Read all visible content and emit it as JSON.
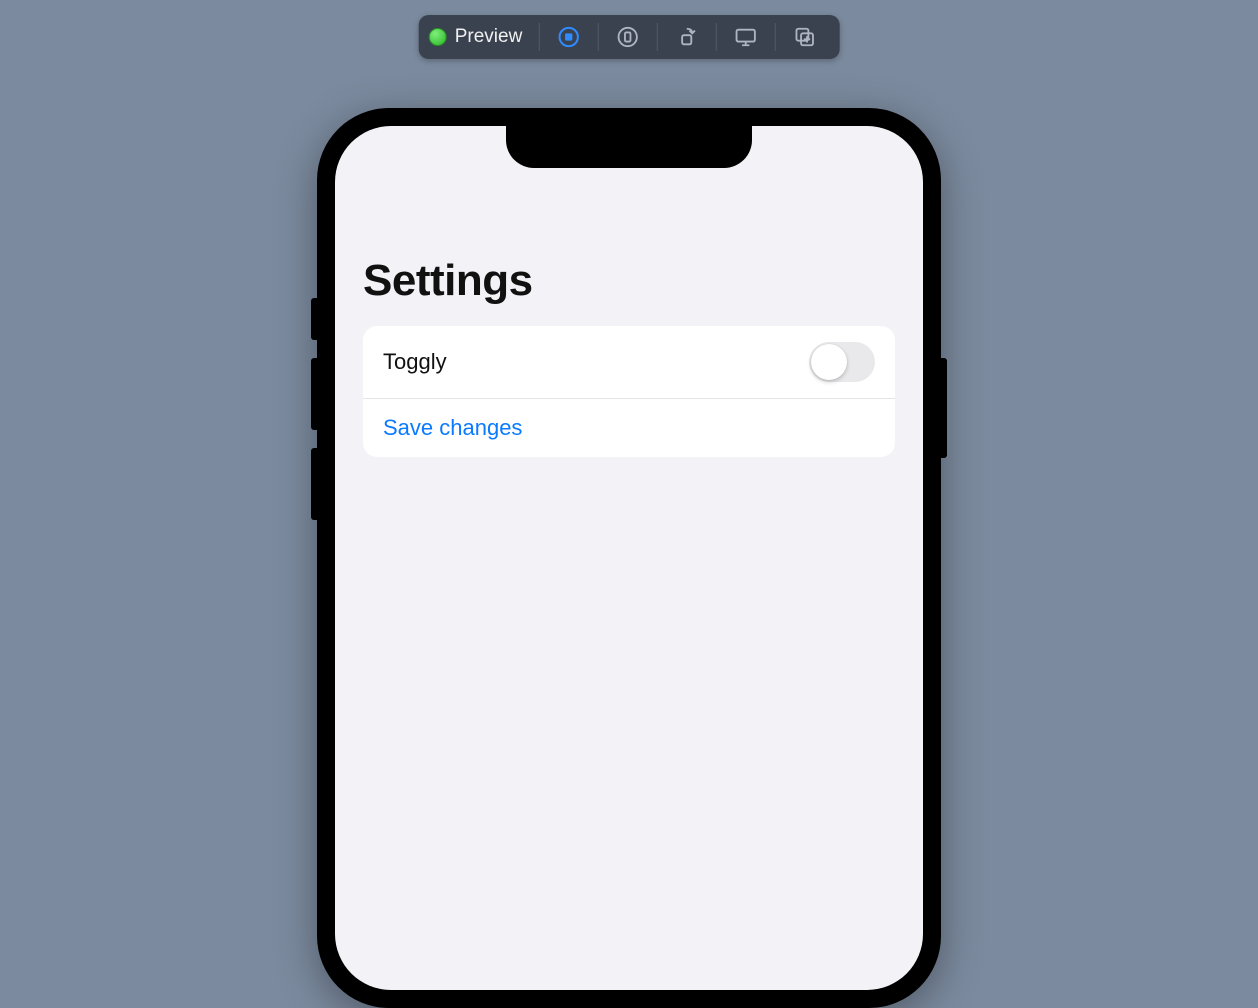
{
  "toolbar": {
    "preview_label": "Preview",
    "status": "running"
  },
  "screen": {
    "title": "Settings",
    "rows": [
      {
        "label": "Toggly",
        "type": "toggle",
        "value": false
      },
      {
        "label": "Save changes",
        "type": "link"
      }
    ]
  }
}
